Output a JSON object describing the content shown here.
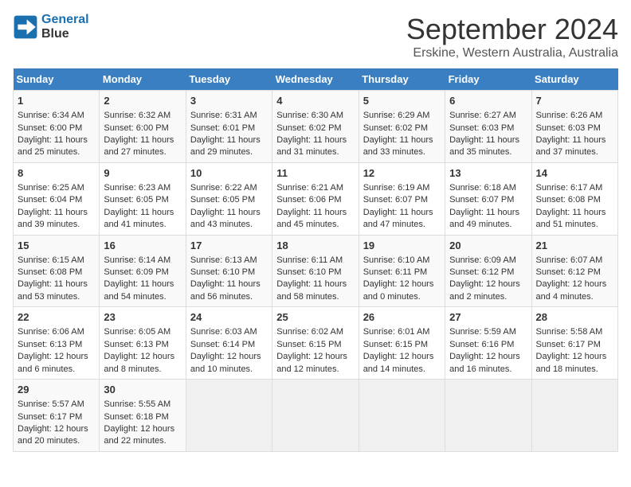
{
  "logo": {
    "line1": "General",
    "line2": "Blue"
  },
  "title": "September 2024",
  "subtitle": "Erskine, Western Australia, Australia",
  "days_of_week": [
    "Sunday",
    "Monday",
    "Tuesday",
    "Wednesday",
    "Thursday",
    "Friday",
    "Saturday"
  ],
  "weeks": [
    [
      {
        "day": "1",
        "lines": [
          "Sunrise: 6:34 AM",
          "Sunset: 6:00 PM",
          "Daylight: 11 hours",
          "and 25 minutes."
        ]
      },
      {
        "day": "2",
        "lines": [
          "Sunrise: 6:32 AM",
          "Sunset: 6:00 PM",
          "Daylight: 11 hours",
          "and 27 minutes."
        ]
      },
      {
        "day": "3",
        "lines": [
          "Sunrise: 6:31 AM",
          "Sunset: 6:01 PM",
          "Daylight: 11 hours",
          "and 29 minutes."
        ]
      },
      {
        "day": "4",
        "lines": [
          "Sunrise: 6:30 AM",
          "Sunset: 6:02 PM",
          "Daylight: 11 hours",
          "and 31 minutes."
        ]
      },
      {
        "day": "5",
        "lines": [
          "Sunrise: 6:29 AM",
          "Sunset: 6:02 PM",
          "Daylight: 11 hours",
          "and 33 minutes."
        ]
      },
      {
        "day": "6",
        "lines": [
          "Sunrise: 6:27 AM",
          "Sunset: 6:03 PM",
          "Daylight: 11 hours",
          "and 35 minutes."
        ]
      },
      {
        "day": "7",
        "lines": [
          "Sunrise: 6:26 AM",
          "Sunset: 6:03 PM",
          "Daylight: 11 hours",
          "and 37 minutes."
        ]
      }
    ],
    [
      {
        "day": "8",
        "lines": [
          "Sunrise: 6:25 AM",
          "Sunset: 6:04 PM",
          "Daylight: 11 hours",
          "and 39 minutes."
        ]
      },
      {
        "day": "9",
        "lines": [
          "Sunrise: 6:23 AM",
          "Sunset: 6:05 PM",
          "Daylight: 11 hours",
          "and 41 minutes."
        ]
      },
      {
        "day": "10",
        "lines": [
          "Sunrise: 6:22 AM",
          "Sunset: 6:05 PM",
          "Daylight: 11 hours",
          "and 43 minutes."
        ]
      },
      {
        "day": "11",
        "lines": [
          "Sunrise: 6:21 AM",
          "Sunset: 6:06 PM",
          "Daylight: 11 hours",
          "and 45 minutes."
        ]
      },
      {
        "day": "12",
        "lines": [
          "Sunrise: 6:19 AM",
          "Sunset: 6:07 PM",
          "Daylight: 11 hours",
          "and 47 minutes."
        ]
      },
      {
        "day": "13",
        "lines": [
          "Sunrise: 6:18 AM",
          "Sunset: 6:07 PM",
          "Daylight: 11 hours",
          "and 49 minutes."
        ]
      },
      {
        "day": "14",
        "lines": [
          "Sunrise: 6:17 AM",
          "Sunset: 6:08 PM",
          "Daylight: 11 hours",
          "and 51 minutes."
        ]
      }
    ],
    [
      {
        "day": "15",
        "lines": [
          "Sunrise: 6:15 AM",
          "Sunset: 6:08 PM",
          "Daylight: 11 hours",
          "and 53 minutes."
        ]
      },
      {
        "day": "16",
        "lines": [
          "Sunrise: 6:14 AM",
          "Sunset: 6:09 PM",
          "Daylight: 11 hours",
          "and 54 minutes."
        ]
      },
      {
        "day": "17",
        "lines": [
          "Sunrise: 6:13 AM",
          "Sunset: 6:10 PM",
          "Daylight: 11 hours",
          "and 56 minutes."
        ]
      },
      {
        "day": "18",
        "lines": [
          "Sunrise: 6:11 AM",
          "Sunset: 6:10 PM",
          "Daylight: 11 hours",
          "and 58 minutes."
        ]
      },
      {
        "day": "19",
        "lines": [
          "Sunrise: 6:10 AM",
          "Sunset: 6:11 PM",
          "Daylight: 12 hours",
          "and 0 minutes."
        ]
      },
      {
        "day": "20",
        "lines": [
          "Sunrise: 6:09 AM",
          "Sunset: 6:12 PM",
          "Daylight: 12 hours",
          "and 2 minutes."
        ]
      },
      {
        "day": "21",
        "lines": [
          "Sunrise: 6:07 AM",
          "Sunset: 6:12 PM",
          "Daylight: 12 hours",
          "and 4 minutes."
        ]
      }
    ],
    [
      {
        "day": "22",
        "lines": [
          "Sunrise: 6:06 AM",
          "Sunset: 6:13 PM",
          "Daylight: 12 hours",
          "and 6 minutes."
        ]
      },
      {
        "day": "23",
        "lines": [
          "Sunrise: 6:05 AM",
          "Sunset: 6:13 PM",
          "Daylight: 12 hours",
          "and 8 minutes."
        ]
      },
      {
        "day": "24",
        "lines": [
          "Sunrise: 6:03 AM",
          "Sunset: 6:14 PM",
          "Daylight: 12 hours",
          "and 10 minutes."
        ]
      },
      {
        "day": "25",
        "lines": [
          "Sunrise: 6:02 AM",
          "Sunset: 6:15 PM",
          "Daylight: 12 hours",
          "and 12 minutes."
        ]
      },
      {
        "day": "26",
        "lines": [
          "Sunrise: 6:01 AM",
          "Sunset: 6:15 PM",
          "Daylight: 12 hours",
          "and 14 minutes."
        ]
      },
      {
        "day": "27",
        "lines": [
          "Sunrise: 5:59 AM",
          "Sunset: 6:16 PM",
          "Daylight: 12 hours",
          "and 16 minutes."
        ]
      },
      {
        "day": "28",
        "lines": [
          "Sunrise: 5:58 AM",
          "Sunset: 6:17 PM",
          "Daylight: 12 hours",
          "and 18 minutes."
        ]
      }
    ],
    [
      {
        "day": "29",
        "lines": [
          "Sunrise: 5:57 AM",
          "Sunset: 6:17 PM",
          "Daylight: 12 hours",
          "and 20 minutes."
        ]
      },
      {
        "day": "30",
        "lines": [
          "Sunrise: 5:55 AM",
          "Sunset: 6:18 PM",
          "Daylight: 12 hours",
          "and 22 minutes."
        ]
      },
      {
        "day": "",
        "lines": []
      },
      {
        "day": "",
        "lines": []
      },
      {
        "day": "",
        "lines": []
      },
      {
        "day": "",
        "lines": []
      },
      {
        "day": "",
        "lines": []
      }
    ]
  ]
}
